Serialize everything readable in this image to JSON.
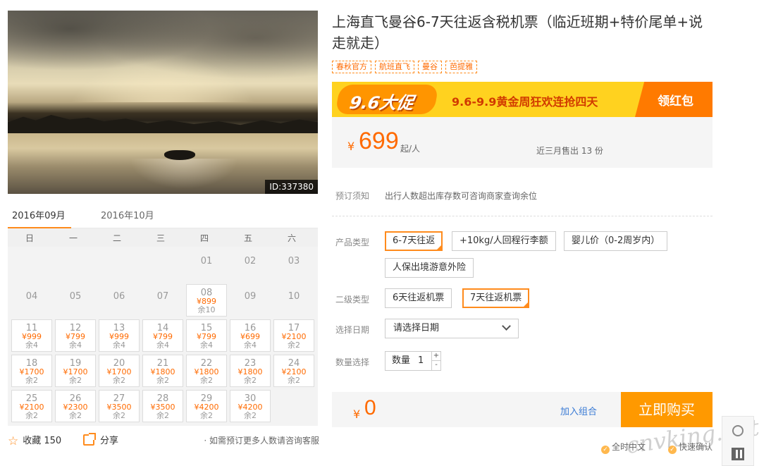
{
  "product": {
    "title": "上海直飞曼谷6-7天往返含税机票（临近班期+特价尾单+说走就走）",
    "tags": [
      "春秋官方",
      "航班直飞",
      "曼谷",
      "芭提雅"
    ],
    "image_id": "ID:337380"
  },
  "promo": {
    "logo": "9.6大促",
    "slogan": "9.6-9.9黄金周狂欢连抢四天",
    "cta": "领红包"
  },
  "price": {
    "currency": "¥",
    "amount": "699",
    "unit": "起/人",
    "sold": "近三月售出 13 份"
  },
  "booking_note": {
    "label": "预订须知",
    "text": "出行人数超出库存数可咨询商家查询余位"
  },
  "product_type": {
    "label": "产品类型",
    "options": [
      "6-7天往返",
      "+10kg/人回程行李额",
      "婴儿价（0-2周岁内）",
      "人保出境游意外险"
    ],
    "selected": "6-7天往返"
  },
  "sub_type": {
    "label": "二级类型",
    "options": [
      "6天往返机票",
      "7天往返机票"
    ],
    "selected": "7天往返机票"
  },
  "date_select": {
    "label": "选择日期",
    "value": "请选择日期"
  },
  "quantity": {
    "label": "数量选择",
    "prefix": "数量",
    "value": "1",
    "up": "+",
    "down": "-"
  },
  "total": {
    "currency": "¥",
    "amount": "0",
    "combo": "加入组合",
    "buy": "立即购买"
  },
  "services": [
    "全时中文",
    "快速确认"
  ],
  "calendar": {
    "tabs": [
      "2016年09月",
      "2016年10月"
    ],
    "active_tab": "2016年09月",
    "weekdays": [
      "日",
      "一",
      "二",
      "三",
      "四",
      "五",
      "六"
    ],
    "days": [
      {
        "d": "01",
        "col": 4,
        "row": 0
      },
      {
        "d": "02",
        "col": 5,
        "row": 0
      },
      {
        "d": "03",
        "col": 6,
        "row": 0
      },
      {
        "d": "04",
        "col": 0,
        "row": 1
      },
      {
        "d": "05",
        "col": 1,
        "row": 1
      },
      {
        "d": "06",
        "col": 2,
        "row": 1
      },
      {
        "d": "07",
        "col": 3,
        "row": 1
      },
      {
        "d": "08",
        "col": 4,
        "row": 1,
        "price": "¥899",
        "remain": "余10"
      },
      {
        "d": "09",
        "col": 5,
        "row": 1
      },
      {
        "d": "10",
        "col": 6,
        "row": 1
      },
      {
        "d": "11",
        "col": 0,
        "row": 2,
        "price": "¥999",
        "remain": "余4"
      },
      {
        "d": "12",
        "col": 1,
        "row": 2,
        "price": "¥799",
        "remain": "余4"
      },
      {
        "d": "13",
        "col": 2,
        "row": 2,
        "price": "¥999",
        "remain": "余4"
      },
      {
        "d": "14",
        "col": 3,
        "row": 2,
        "price": "¥799",
        "remain": "余4"
      },
      {
        "d": "15",
        "col": 4,
        "row": 2,
        "price": "¥799",
        "remain": "余4"
      },
      {
        "d": "16",
        "col": 5,
        "row": 2,
        "price": "¥699",
        "remain": "余4"
      },
      {
        "d": "17",
        "col": 6,
        "row": 2,
        "price": "¥2100",
        "remain": "余2"
      },
      {
        "d": "18",
        "col": 0,
        "row": 3,
        "price": "¥1700",
        "remain": "余2"
      },
      {
        "d": "19",
        "col": 1,
        "row": 3,
        "price": "¥1700",
        "remain": "余2"
      },
      {
        "d": "20",
        "col": 2,
        "row": 3,
        "price": "¥1700",
        "remain": "余2"
      },
      {
        "d": "21",
        "col": 3,
        "row": 3,
        "price": "¥1800",
        "remain": "余2"
      },
      {
        "d": "22",
        "col": 4,
        "row": 3,
        "price": "¥1800",
        "remain": "余2"
      },
      {
        "d": "23",
        "col": 5,
        "row": 3,
        "price": "¥1800",
        "remain": "余2"
      },
      {
        "d": "24",
        "col": 6,
        "row": 3,
        "price": "¥2100",
        "remain": "余2"
      },
      {
        "d": "25",
        "col": 0,
        "row": 4,
        "price": "¥2100",
        "remain": "余2"
      },
      {
        "d": "26",
        "col": 1,
        "row": 4,
        "price": "¥2300",
        "remain": "余2"
      },
      {
        "d": "27",
        "col": 2,
        "row": 4,
        "price": "¥3500",
        "remain": "余2"
      },
      {
        "d": "28",
        "col": 3,
        "row": 4,
        "price": "¥3500",
        "remain": "余2"
      },
      {
        "d": "29",
        "col": 4,
        "row": 4,
        "price": "¥4200",
        "remain": "余2"
      },
      {
        "d": "30",
        "col": 5,
        "row": 4,
        "price": "¥4200",
        "remain": "余2"
      }
    ]
  },
  "actions": {
    "favorite": "收藏 150",
    "share": "分享",
    "note": "· 如需预订更多人数请咨询客服"
  },
  "watermark": "cnvking.net",
  "colors": {
    "accent": "#ff8b1c",
    "price": "#ff6a00",
    "link": "#3a7bd5",
    "buy": "#ff9900",
    "banner": "#ffd21f"
  }
}
